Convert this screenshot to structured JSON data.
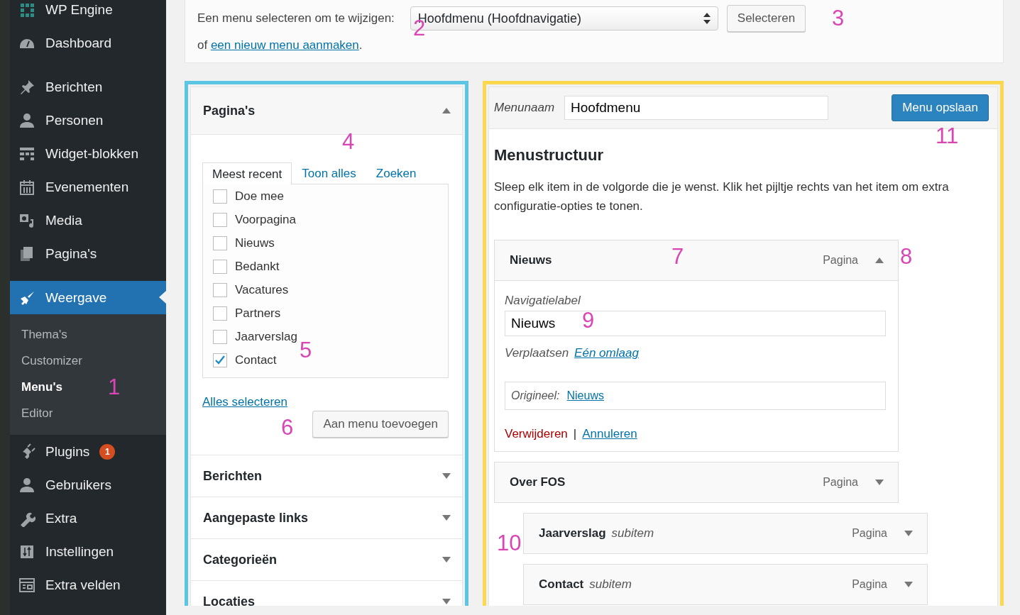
{
  "sidebar": {
    "groups": [
      [
        {
          "label": "WP Engine",
          "selected": false
        },
        {
          "label": "Dashboard",
          "selected": false
        }
      ],
      [
        {
          "label": "Berichten",
          "selected": false
        },
        {
          "label": "Personen",
          "selected": false
        },
        {
          "label": "Widget-blokken",
          "selected": false
        },
        {
          "label": "Evenementen",
          "selected": false
        },
        {
          "label": "Media",
          "selected": false
        },
        {
          "label": "Pagina's",
          "selected": false
        }
      ],
      [
        {
          "label": "Weergave",
          "selected": true,
          "expanded": true,
          "children": [
            {
              "label": "Thema's",
              "selected": false
            },
            {
              "label": "Customizer",
              "selected": false
            },
            {
              "label": "Menu's",
              "selected": true
            },
            {
              "label": "Editor",
              "selected": false
            }
          ]
        },
        {
          "label": "Plugins",
          "selected": false,
          "badge": "1"
        },
        {
          "label": "Gebruikers",
          "selected": false
        },
        {
          "label": "Extra",
          "selected": false
        },
        {
          "label": "Instellingen",
          "selected": false
        },
        {
          "label": "Extra velden",
          "selected": false
        }
      ]
    ]
  },
  "menu_select": {
    "label": "Een menu selecteren om te wijzigen:",
    "value": "Hoofdmenu (Hoofdnavigatie)",
    "button": "Selecteren",
    "create_prefix": "of",
    "create_link": "een nieuw menu aanmaken",
    "create_suffix": "."
  },
  "add_items": {
    "sections": [
      {
        "title": "Pagina's",
        "expanded": true,
        "tabs": [
          {
            "label": "Meest recent",
            "selected": true
          },
          {
            "label": "Toon alles",
            "selected": false
          },
          {
            "label": "Zoeken",
            "selected": false
          }
        ],
        "items": [
          {
            "label": "Doe mee",
            "checked": false
          },
          {
            "label": "Voorpagina",
            "checked": false
          },
          {
            "label": "Nieuws",
            "checked": false
          },
          {
            "label": "Bedankt",
            "checked": false
          },
          {
            "label": "Vacatures",
            "checked": false
          },
          {
            "label": "Partners",
            "checked": false
          },
          {
            "label": "Jaarverslag",
            "checked": false
          },
          {
            "label": "Contact",
            "checked": true
          }
        ],
        "select_all": "Alles selecteren",
        "add_button": "Aan menu toevoegen"
      },
      {
        "title": "Berichten",
        "expanded": false
      },
      {
        "title": "Aangepaste links",
        "expanded": false
      },
      {
        "title": "Categorieën",
        "expanded": false
      },
      {
        "title": "Locaties",
        "expanded": false
      }
    ]
  },
  "menu_edit": {
    "name_label": "Menunaam",
    "name_value": "Hoofdmenu",
    "save_button": "Menu opslaan",
    "heading": "Menustructuur",
    "description": "Sleep elk item in de volgorde die je wenst. Klik het pijltje rechts van het item om extra configuratie-opties te tonen.",
    "items": [
      {
        "title": "Nieuws",
        "type": "Pagina",
        "expanded": true,
        "nav_label": "Navigatielabel",
        "nav_value": "Nieuws",
        "move_label": "Verplaatsen",
        "move_link": "Eén omlaag",
        "original_label": "Origineel:",
        "original_link": "Nieuws",
        "delete": "Verwijderen",
        "divider": "|",
        "cancel": "Annuleren"
      },
      {
        "title": "Over FOS",
        "type": "Pagina",
        "expanded": false,
        "children": [
          {
            "title": "Jaarverslag",
            "subtitle": "subitem",
            "type": "Pagina",
            "expanded": false
          },
          {
            "title": "Contact",
            "subtitle": "subitem",
            "type": "Pagina",
            "expanded": false
          }
        ]
      }
    ]
  },
  "annotations": [
    "1",
    "2",
    "3",
    "4",
    "5",
    "6",
    "7",
    "8",
    "9",
    "10",
    "11"
  ]
}
